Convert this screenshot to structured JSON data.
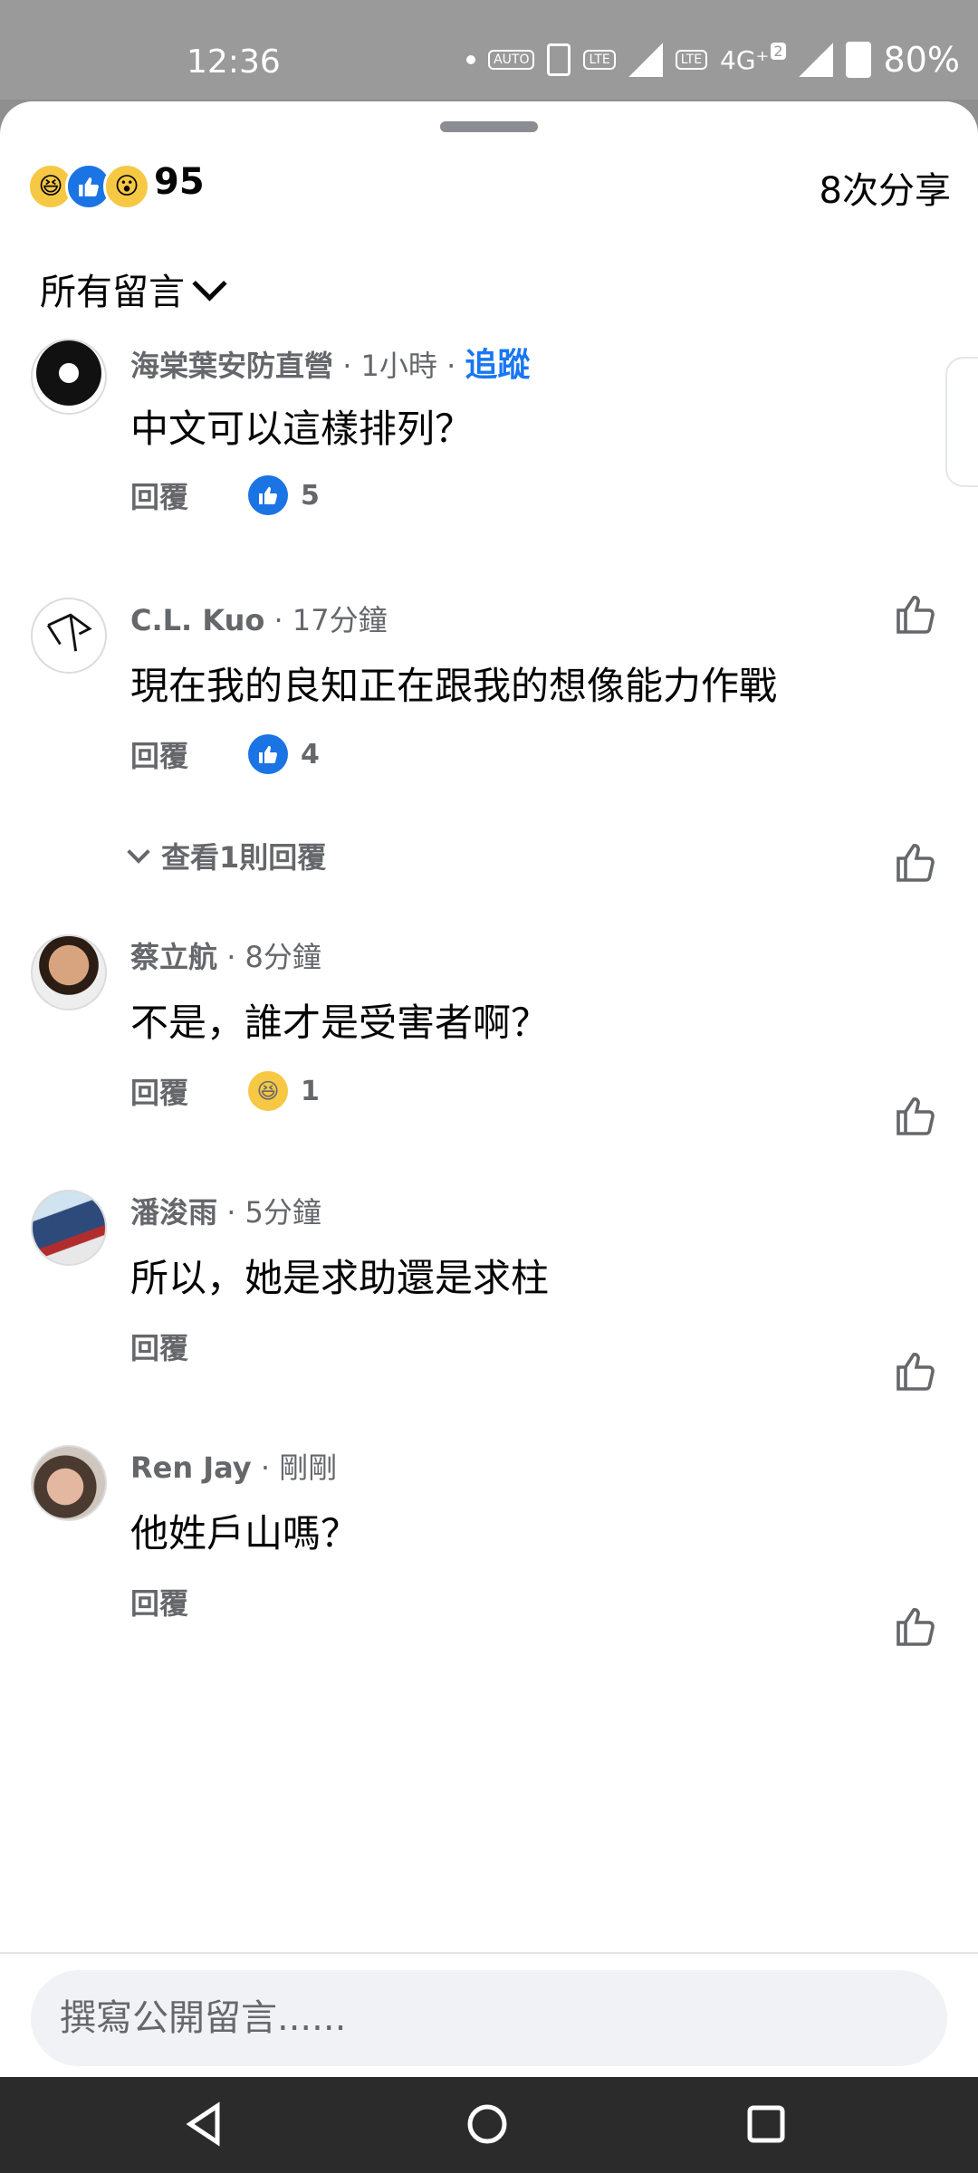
{
  "status_bar": {
    "time": "12:36",
    "network_chip_1": "AUTO",
    "network_chip_2": "LTE",
    "network_chip_3": "LTE",
    "network_type": "4G⁺",
    "sim_badge": "2",
    "battery": "80%"
  },
  "header": {
    "reaction_count": "95",
    "reaction_icons": [
      "haha-icon",
      "like-icon",
      "wow-icon"
    ],
    "share_count": "8次分享",
    "filter_label": "所有留言"
  },
  "comments": [
    {
      "author": "海棠葉安防直營",
      "time": "· 1小時 ·",
      "follow": "追蹤",
      "text": "中文可以這樣排列？",
      "reply": "回覆",
      "reaction_count": "5",
      "reaction_type": "like"
    },
    {
      "author": "C.L. Kuo",
      "time": "· 17分鐘",
      "text": "現在我的良知正在跟我的想像能力作戰",
      "reply": "回覆",
      "reaction_count": "4",
      "reaction_type": "like"
    },
    {
      "author": "蔡立航",
      "time": "· 8分鐘",
      "text": "不是，誰才是受害者啊？",
      "reply": "回覆",
      "reaction_count": "1",
      "reaction_type": "haha"
    },
    {
      "author": "潘浚雨",
      "time": "· 5分鐘",
      "text": "所以，她是求助還是求柱",
      "reply": "回覆"
    },
    {
      "author": "Ren Jay",
      "time": "· 剛剛",
      "text": "他姓戶山嗎？",
      "reply": "回覆"
    }
  ],
  "view_replies": "查看1則回覆",
  "composer": {
    "placeholder": "撰寫公開留言......"
  },
  "colors": {
    "accent": "#1877f2",
    "secondary_text": "#65676b",
    "composer_bg": "#f0f2f5"
  }
}
